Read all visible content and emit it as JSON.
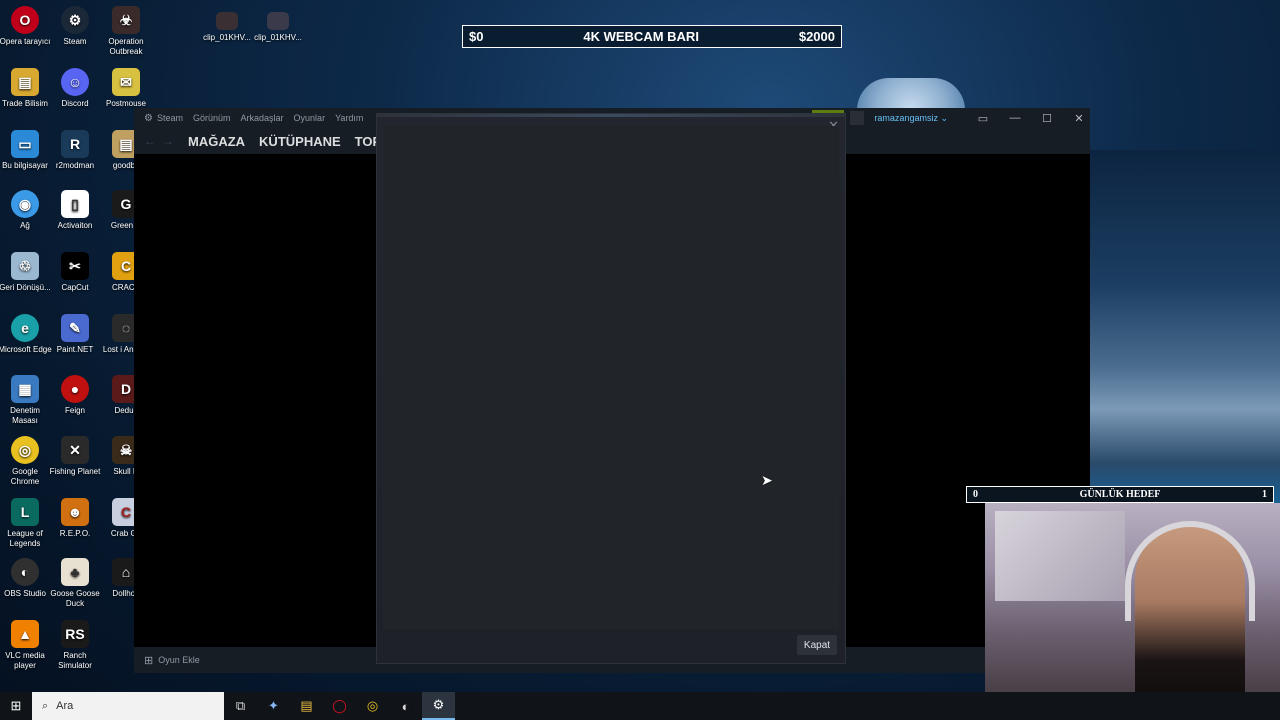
{
  "desktop": {
    "col1": [
      "Opera tarayıcı",
      "Trade Bilisim",
      "Bu bilgisayar",
      "Ağ",
      "Geri Dönüşü...",
      "Microsoft Edge",
      "Denetim Masası",
      "Google Chrome",
      "League of Legends",
      "OBS Studio",
      "VLC media player"
    ],
    "col2": [
      "Steam",
      "Discord",
      "r2modman",
      "Activaiton",
      "CapCut",
      "Paint.NET",
      "Feign",
      "Fishing Planet",
      "R.E.P.O.",
      "Goose Goose Duck",
      "Ranch Simulator"
    ],
    "col3": [
      "Operation Outbreak",
      "Postmouse",
      "goodby",
      "Green H",
      "CRACK",
      "Lost i Anoma",
      "Deduc",
      "Skull H",
      "Crab Ga",
      "Dollhou"
    ],
    "clips": [
      "clip_01KHV...",
      "clip_01KHV..."
    ]
  },
  "webcam_bar": {
    "left": "$0",
    "title": "4K WEBCAM BARI",
    "right": "$2000"
  },
  "steam": {
    "menu": [
      "Steam",
      "Görünüm",
      "Arkadaşlar",
      "Oyunlar",
      "Yardım"
    ],
    "nav": [
      "MAĞAZA",
      "KÜTÜPHANE",
      "TOPLU"
    ],
    "username": "ramazangamsiz ⌄",
    "footer_add": "Oyun Ekle"
  },
  "dialog": {
    "close_label": "Kapat"
  },
  "goal": {
    "left": "0",
    "title": "GÜNLÜK HEDEF",
    "right": "1"
  },
  "taskbar": {
    "search_placeholder": "Ara"
  }
}
